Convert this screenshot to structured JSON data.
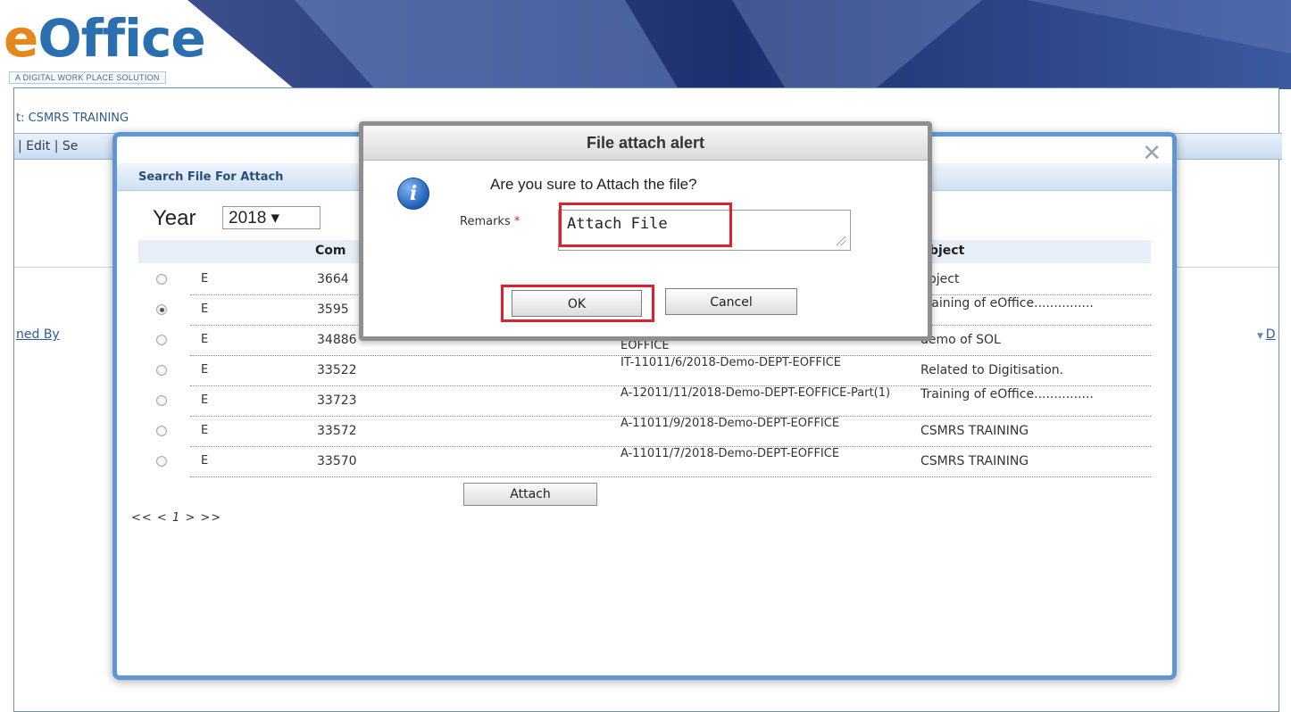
{
  "header": {
    "logo_initial": "e",
    "logo_rest": "Office",
    "tagline": "A DIGITAL WORK PLACE SOLUTION"
  },
  "app": {
    "file_title": "t: CSMRS TRAINING",
    "menu_text": "| Edit | Se",
    "left_column_link": "ned By",
    "right_column_link": "D"
  },
  "search_modal": {
    "title": "Search File For Attach",
    "year_label": "Year",
    "year_value": "2018 ▾",
    "columns": {
      "comp": "Com",
      "subject": "ubject"
    },
    "rows": [
      {
        "type": "E",
        "comp": "3664",
        "file": "",
        "subject": "ubject",
        "selected": false
      },
      {
        "type": "E",
        "comp": "3595",
        "file": "",
        "subject": "Training of eOffice...............",
        "selected": true
      },
      {
        "type": "E",
        "comp": "34886",
        "file": "EOFFICE",
        "subject": "demo of SOL",
        "selected": false
      },
      {
        "type": "E",
        "comp": "33522",
        "file": "IT-11011/6/2018-Demo-DEPT-EOFFICE",
        "subject": "Related to Digitisation.",
        "selected": false
      },
      {
        "type": "E",
        "comp": "33723",
        "file": "A-12011/11/2018-Demo-DEPT-EOFFICE-Part(1)",
        "subject": "Training of eOffice...............",
        "selected": false
      },
      {
        "type": "E",
        "comp": "33572",
        "file": "A-11011/9/2018-Demo-DEPT-EOFFICE",
        "subject": "CSMRS TRAINING",
        "selected": false
      },
      {
        "type": "E",
        "comp": "33570",
        "file": "A-11011/7/2018-Demo-DEPT-EOFFICE",
        "subject": "CSMRS TRAINING",
        "selected": false
      }
    ],
    "attach_label": "Attach",
    "pager": "<< < 1 > >>",
    "close_glyph": "✕"
  },
  "alert": {
    "title": "File attach alert",
    "icon": "info-icon",
    "question": "Are you sure to Attach the file?",
    "remarks_label": "Remarks",
    "required_mark": "*",
    "remarks_value": "Attach File",
    "ok_label": "OK",
    "cancel_label": "Cancel",
    "highlight_color": "#e0202e"
  }
}
